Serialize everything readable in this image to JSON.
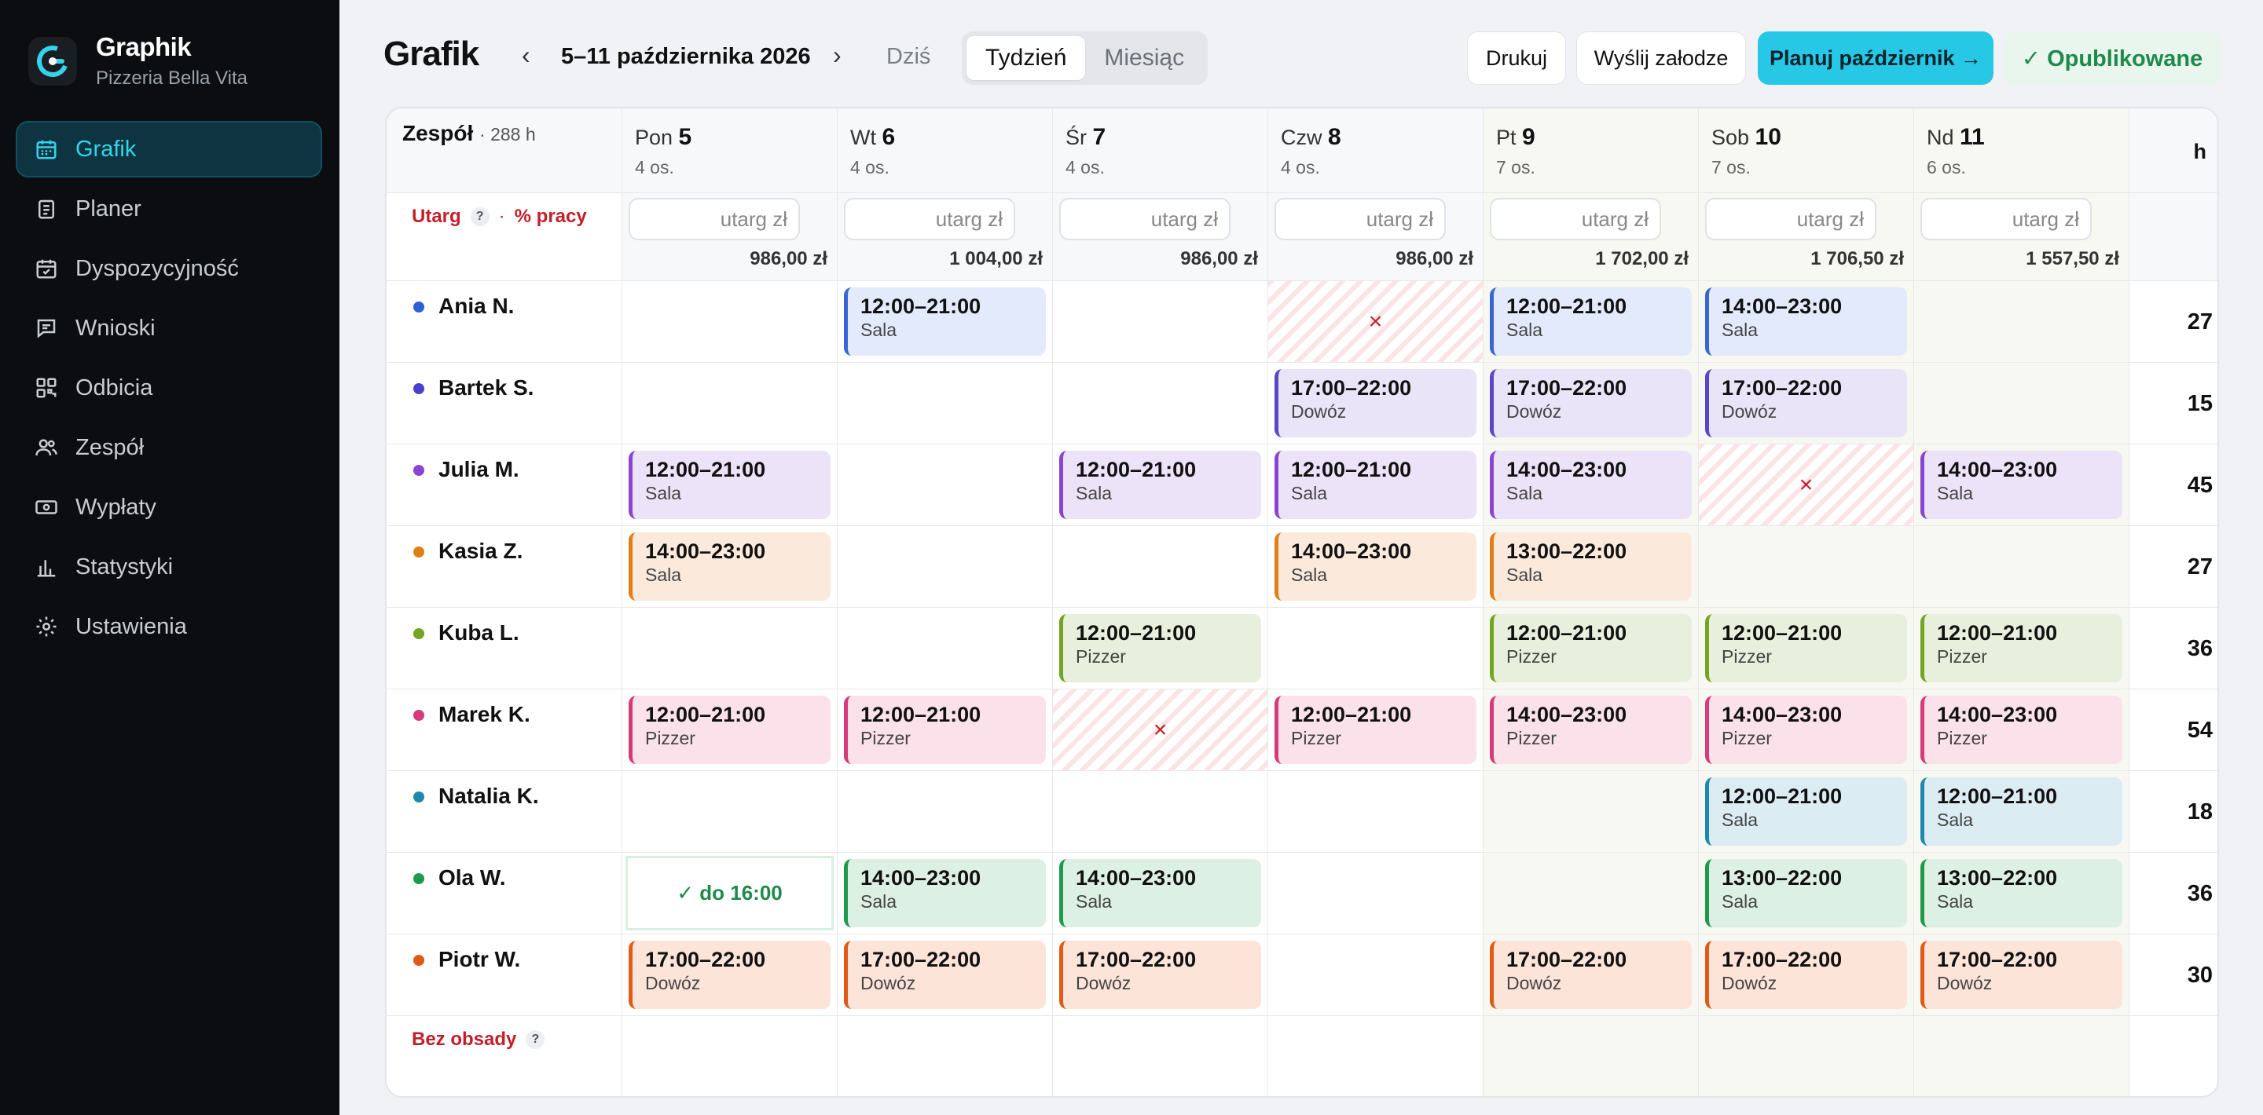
{
  "app": {
    "name": "Graphik",
    "subtitle": "Pizzeria Bella Vita"
  },
  "sidebar": {
    "items": [
      {
        "label": "Grafik",
        "icon": "calendar-icon",
        "active": true
      },
      {
        "label": "Planer",
        "icon": "clipboard-icon"
      },
      {
        "label": "Dyspozycyjność",
        "icon": "calendar-check-icon"
      },
      {
        "label": "Wnioski",
        "icon": "message-icon"
      },
      {
        "label": "Odbicia",
        "icon": "qr-icon"
      },
      {
        "label": "Zespół",
        "icon": "users-icon"
      },
      {
        "label": "Wypłaty",
        "icon": "money-icon"
      },
      {
        "label": "Statystyki",
        "icon": "bar-chart-icon"
      },
      {
        "label": "Ustawienia",
        "icon": "gear-icon"
      }
    ]
  },
  "header": {
    "title": "Grafik",
    "prev": "‹",
    "next": "›",
    "week_range": "5–11 października 2026",
    "today": "Dziś",
    "view_week": "Tydzień",
    "view_month": "Miesiąc",
    "print": "Drukuj",
    "send": "Wyślij załodze",
    "plan": "Planuj październik →",
    "published": "✓ Opublikowane"
  },
  "table": {
    "team_label": "Zespół",
    "team_hours": "· 288 h",
    "hours_header": "h",
    "revenue_label": "Utarg",
    "revenue_sep": "·",
    "work_pct_label": "% pracy",
    "revenue_placeholder": "utarg zł",
    "unassigned_label": "Bez obsady",
    "help": "?",
    "days": [
      {
        "name": "Pon",
        "num": "5",
        "count": "4 os.",
        "revenue": "986,00 zł",
        "weekend": false
      },
      {
        "name": "Wt",
        "num": "6",
        "count": "4 os.",
        "revenue": "1 004,00 zł",
        "weekend": false
      },
      {
        "name": "Śr",
        "num": "7",
        "count": "4 os.",
        "revenue": "986,00 zł",
        "weekend": false
      },
      {
        "name": "Czw",
        "num": "8",
        "count": "4 os.",
        "revenue": "986,00 zł",
        "weekend": false
      },
      {
        "name": "Pt",
        "num": "9",
        "count": "7 os.",
        "revenue": "1 702,00 zł",
        "weekend": true
      },
      {
        "name": "Sob",
        "num": "10",
        "count": "7 os.",
        "revenue": "1 706,50 zł",
        "weekend": true
      },
      {
        "name": "Nd",
        "num": "11",
        "count": "6 os.",
        "revenue": "1 557,50 zł",
        "weekend": true
      }
    ]
  },
  "role_colors": {
    "Sala_blue": {
      "bg": "#e3eafb",
      "border": "#3a66d4"
    },
    "Dowoz_purple": {
      "bg": "#e9e4f8",
      "border": "#5b46c9"
    },
    "Sala_violet": {
      "bg": "#ece3f8",
      "border": "#8a44d2"
    },
    "Sala_orange": {
      "bg": "#fbeadc",
      "border": "#e07f17"
    },
    "Pizzer_green": {
      "bg": "#e8f0dd",
      "border": "#73a523"
    },
    "Pizzer_pink": {
      "bg": "#fbe1ea",
      "border": "#d63a79"
    },
    "Sala_teal": {
      "bg": "#dcecf3",
      "border": "#1e8aab"
    },
    "Sala_green": {
      "bg": "#dcf0e3",
      "border": "#1f9a4c"
    },
    "Dowoz_orange": {
      "bg": "#fde4d8",
      "border": "#e05a18"
    }
  },
  "employees": [
    {
      "name": "Ania N.",
      "dot": "#2f5fd6",
      "hours": "27",
      "color": "Sala_blue",
      "days": [
        null,
        {
          "t": "12:00–21:00",
          "r": "Sala"
        },
        null,
        "x",
        {
          "t": "12:00–21:00",
          "r": "Sala"
        },
        {
          "t": "14:00–23:00",
          "r": "Sala"
        },
        null
      ]
    },
    {
      "name": "Bartek S.",
      "dot": "#4a3fcf",
      "hours": "15",
      "color": "Dowoz_purple",
      "days": [
        null,
        null,
        null,
        {
          "t": "17:00–22:00",
          "r": "Dowóz"
        },
        {
          "t": "17:00–22:00",
          "r": "Dowóz"
        },
        {
          "t": "17:00–22:00",
          "r": "Dowóz"
        },
        null
      ]
    },
    {
      "name": "Julia M.",
      "dot": "#8a44d2",
      "hours": "45",
      "color": "Sala_violet",
      "days": [
        {
          "t": "12:00–21:00",
          "r": "Sala"
        },
        null,
        {
          "t": "12:00–21:00",
          "r": "Sala"
        },
        {
          "t": "12:00–21:00",
          "r": "Sala"
        },
        {
          "t": "14:00–23:00",
          "r": "Sala"
        },
        "x",
        {
          "t": "14:00–23:00",
          "r": "Sala"
        }
      ]
    },
    {
      "name": "Kasia Z.",
      "dot": "#e07f17",
      "hours": "27",
      "color": "Sala_orange",
      "days": [
        {
          "t": "14:00–23:00",
          "r": "Sala"
        },
        null,
        null,
        {
          "t": "14:00–23:00",
          "r": "Sala"
        },
        {
          "t": "13:00–22:00",
          "r": "Sala"
        },
        null,
        null
      ]
    },
    {
      "name": "Kuba L.",
      "dot": "#73a523",
      "hours": "36",
      "color": "Pizzer_green",
      "days": [
        null,
        null,
        {
          "t": "12:00–21:00",
          "r": "Pizzer"
        },
        null,
        {
          "t": "12:00–21:00",
          "r": "Pizzer"
        },
        {
          "t": "12:00–21:00",
          "r": "Pizzer"
        },
        {
          "t": "12:00–21:00",
          "r": "Pizzer"
        }
      ]
    },
    {
      "name": "Marek K.",
      "dot": "#d63a79",
      "hours": "54",
      "color": "Pizzer_pink",
      "days": [
        {
          "t": "12:00–21:00",
          "r": "Pizzer"
        },
        {
          "t": "12:00–21:00",
          "r": "Pizzer"
        },
        "x",
        {
          "t": "12:00–21:00",
          "r": "Pizzer"
        },
        {
          "t": "14:00–23:00",
          "r": "Pizzer"
        },
        {
          "t": "14:00–23:00",
          "r": "Pizzer"
        },
        {
          "t": "14:00–23:00",
          "r": "Pizzer"
        }
      ]
    },
    {
      "name": "Natalia K.",
      "dot": "#1e8aab",
      "hours": "18",
      "color": "Sala_teal",
      "days": [
        null,
        null,
        null,
        null,
        null,
        {
          "t": "12:00–21:00",
          "r": "Sala"
        },
        {
          "t": "12:00–21:00",
          "r": "Sala"
        }
      ]
    },
    {
      "name": "Ola W.",
      "dot": "#1f9a4c",
      "hours": "36",
      "color": "Sala_green",
      "days": [
        "✓ do 16:00",
        {
          "t": "14:00–23:00",
          "r": "Sala"
        },
        {
          "t": "14:00–23:00",
          "r": "Sala"
        },
        null,
        null,
        {
          "t": "13:00–22:00",
          "r": "Sala"
        },
        {
          "t": "13:00–22:00",
          "r": "Sala"
        }
      ]
    },
    {
      "name": "Piotr W.",
      "dot": "#e05a18",
      "hours": "30",
      "color": "Dowoz_orange",
      "days": [
        {
          "t": "17:00–22:00",
          "r": "Dowóz"
        },
        {
          "t": "17:00–22:00",
          "r": "Dowóz"
        },
        {
          "t": "17:00–22:00",
          "r": "Dowóz"
        },
        null,
        {
          "t": "17:00–22:00",
          "r": "Dowóz"
        },
        {
          "t": "17:00–22:00",
          "r": "Dowóz"
        },
        {
          "t": "17:00–22:00",
          "r": "Dowóz"
        }
      ]
    }
  ],
  "unavailable_mark": "×"
}
